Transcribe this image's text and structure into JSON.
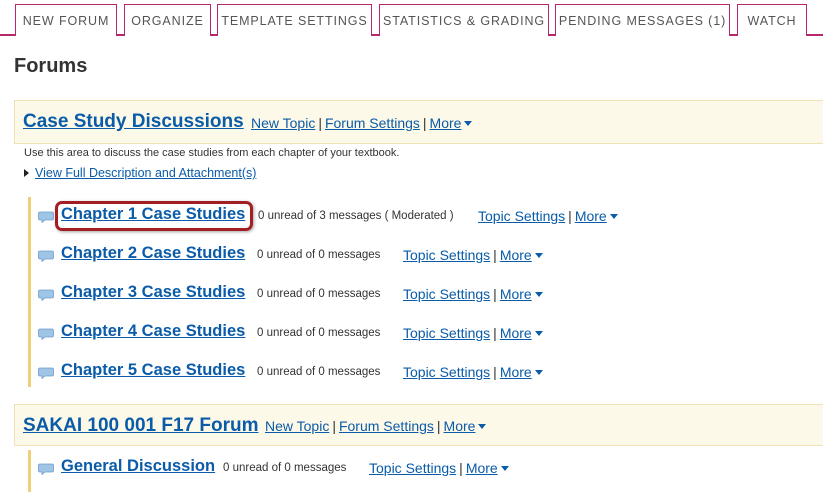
{
  "toolbar": {
    "tabs": [
      {
        "label": "NEW FORUM"
      },
      {
        "label": "ORGANIZE"
      },
      {
        "label": "TEMPLATE SETTINGS"
      },
      {
        "label": "STATISTICS & GRADING"
      },
      {
        "label": "PENDING MESSAGES (1)"
      },
      {
        "label": "WATCH"
      }
    ]
  },
  "page": {
    "title": "Forums"
  },
  "forums": [
    {
      "title": "Case Study Discussions",
      "new_topic": "New Topic",
      "forum_settings": "Forum Settings",
      "more": "More",
      "separator": "|",
      "description": "Use this area to discuss the case studies from each chapter of your textbook.",
      "full_description_link": "View Full Description and Attachment(s)",
      "topics": [
        {
          "title": "Chapter 1 Case Studies",
          "count": "0 unread of 3 messages ( Moderated )",
          "topic_settings": "Topic Settings",
          "more": "More"
        },
        {
          "title": "Chapter 2 Case Studies",
          "count": "0 unread of 0 messages",
          "topic_settings": "Topic Settings",
          "more": "More"
        },
        {
          "title": "Chapter 3 Case Studies",
          "count": "0 unread of 0 messages",
          "topic_settings": "Topic Settings",
          "more": "More"
        },
        {
          "title": "Chapter 4 Case Studies",
          "count": "0 unread of 0 messages",
          "topic_settings": "Topic Settings",
          "more": "More"
        },
        {
          "title": "Chapter 5 Case Studies",
          "count": "0 unread of 0 messages",
          "topic_settings": "Topic Settings",
          "more": "More"
        }
      ]
    },
    {
      "title": "SAKAI 100 001 F17 Forum",
      "new_topic": "New Topic",
      "forum_settings": "Forum Settings",
      "more": "More",
      "separator": "|",
      "topics": [
        {
          "title": "General Discussion",
          "count": "0 unread of 0 messages",
          "topic_settings": "Topic Settings",
          "more": "More"
        }
      ]
    }
  ],
  "colors": {
    "accent": "#b5286b",
    "link": "#0a5ba8",
    "forum_bg": "#fdf9e9",
    "highlight": "#a31e22"
  },
  "icons": {
    "topic": "speech-bubble-icon",
    "more": "caret-down-icon",
    "expand": "triangle-right-icon"
  }
}
